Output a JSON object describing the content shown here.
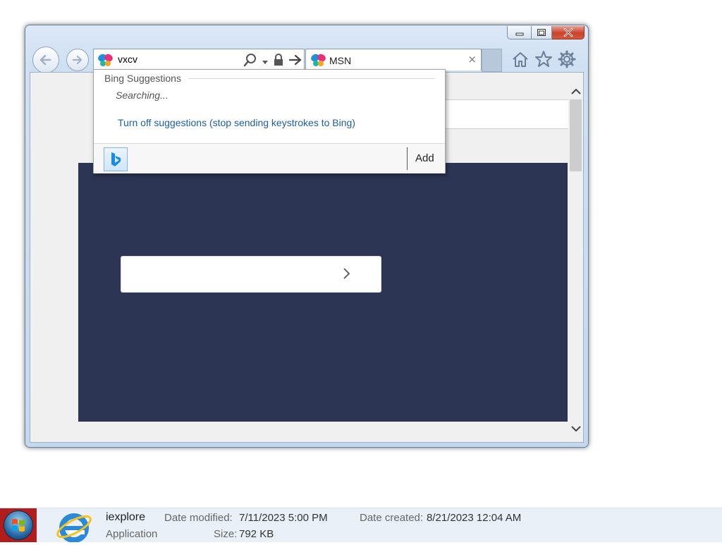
{
  "address_bar": {
    "value": "vxcv",
    "icons": [
      "favicon",
      "search-icon",
      "dropdown-arrow-icon",
      "lock-icon",
      "go-arrow-icon"
    ]
  },
  "tab": {
    "title": "MSN",
    "close_glyph": "×"
  },
  "window_controls": [
    "minimize-icon",
    "maximize-icon",
    "close-icon"
  ],
  "toolbar_icons": [
    "home-icon",
    "favorites-star-icon",
    "gear-icon"
  ],
  "suggestions": {
    "header": "Bing Suggestions",
    "status": "Searching...",
    "turn_off_link": "Turn off suggestions (stop sending keystrokes to Bing)",
    "add_label": "Add"
  },
  "details": {
    "file_name": "iexplore",
    "file_type": "Application",
    "date_modified_label": "Date modified:",
    "date_modified": "7/11/2023 5:00 PM",
    "date_created_label": "Date created:",
    "date_created": "8/21/2023 12:04 AM",
    "size_label": "Size:",
    "size": "792 KB"
  },
  "colors": {
    "hero_bg": "#2c3654",
    "link_blue": "#1c5ea8",
    "start_bg": "#b11d1d"
  }
}
